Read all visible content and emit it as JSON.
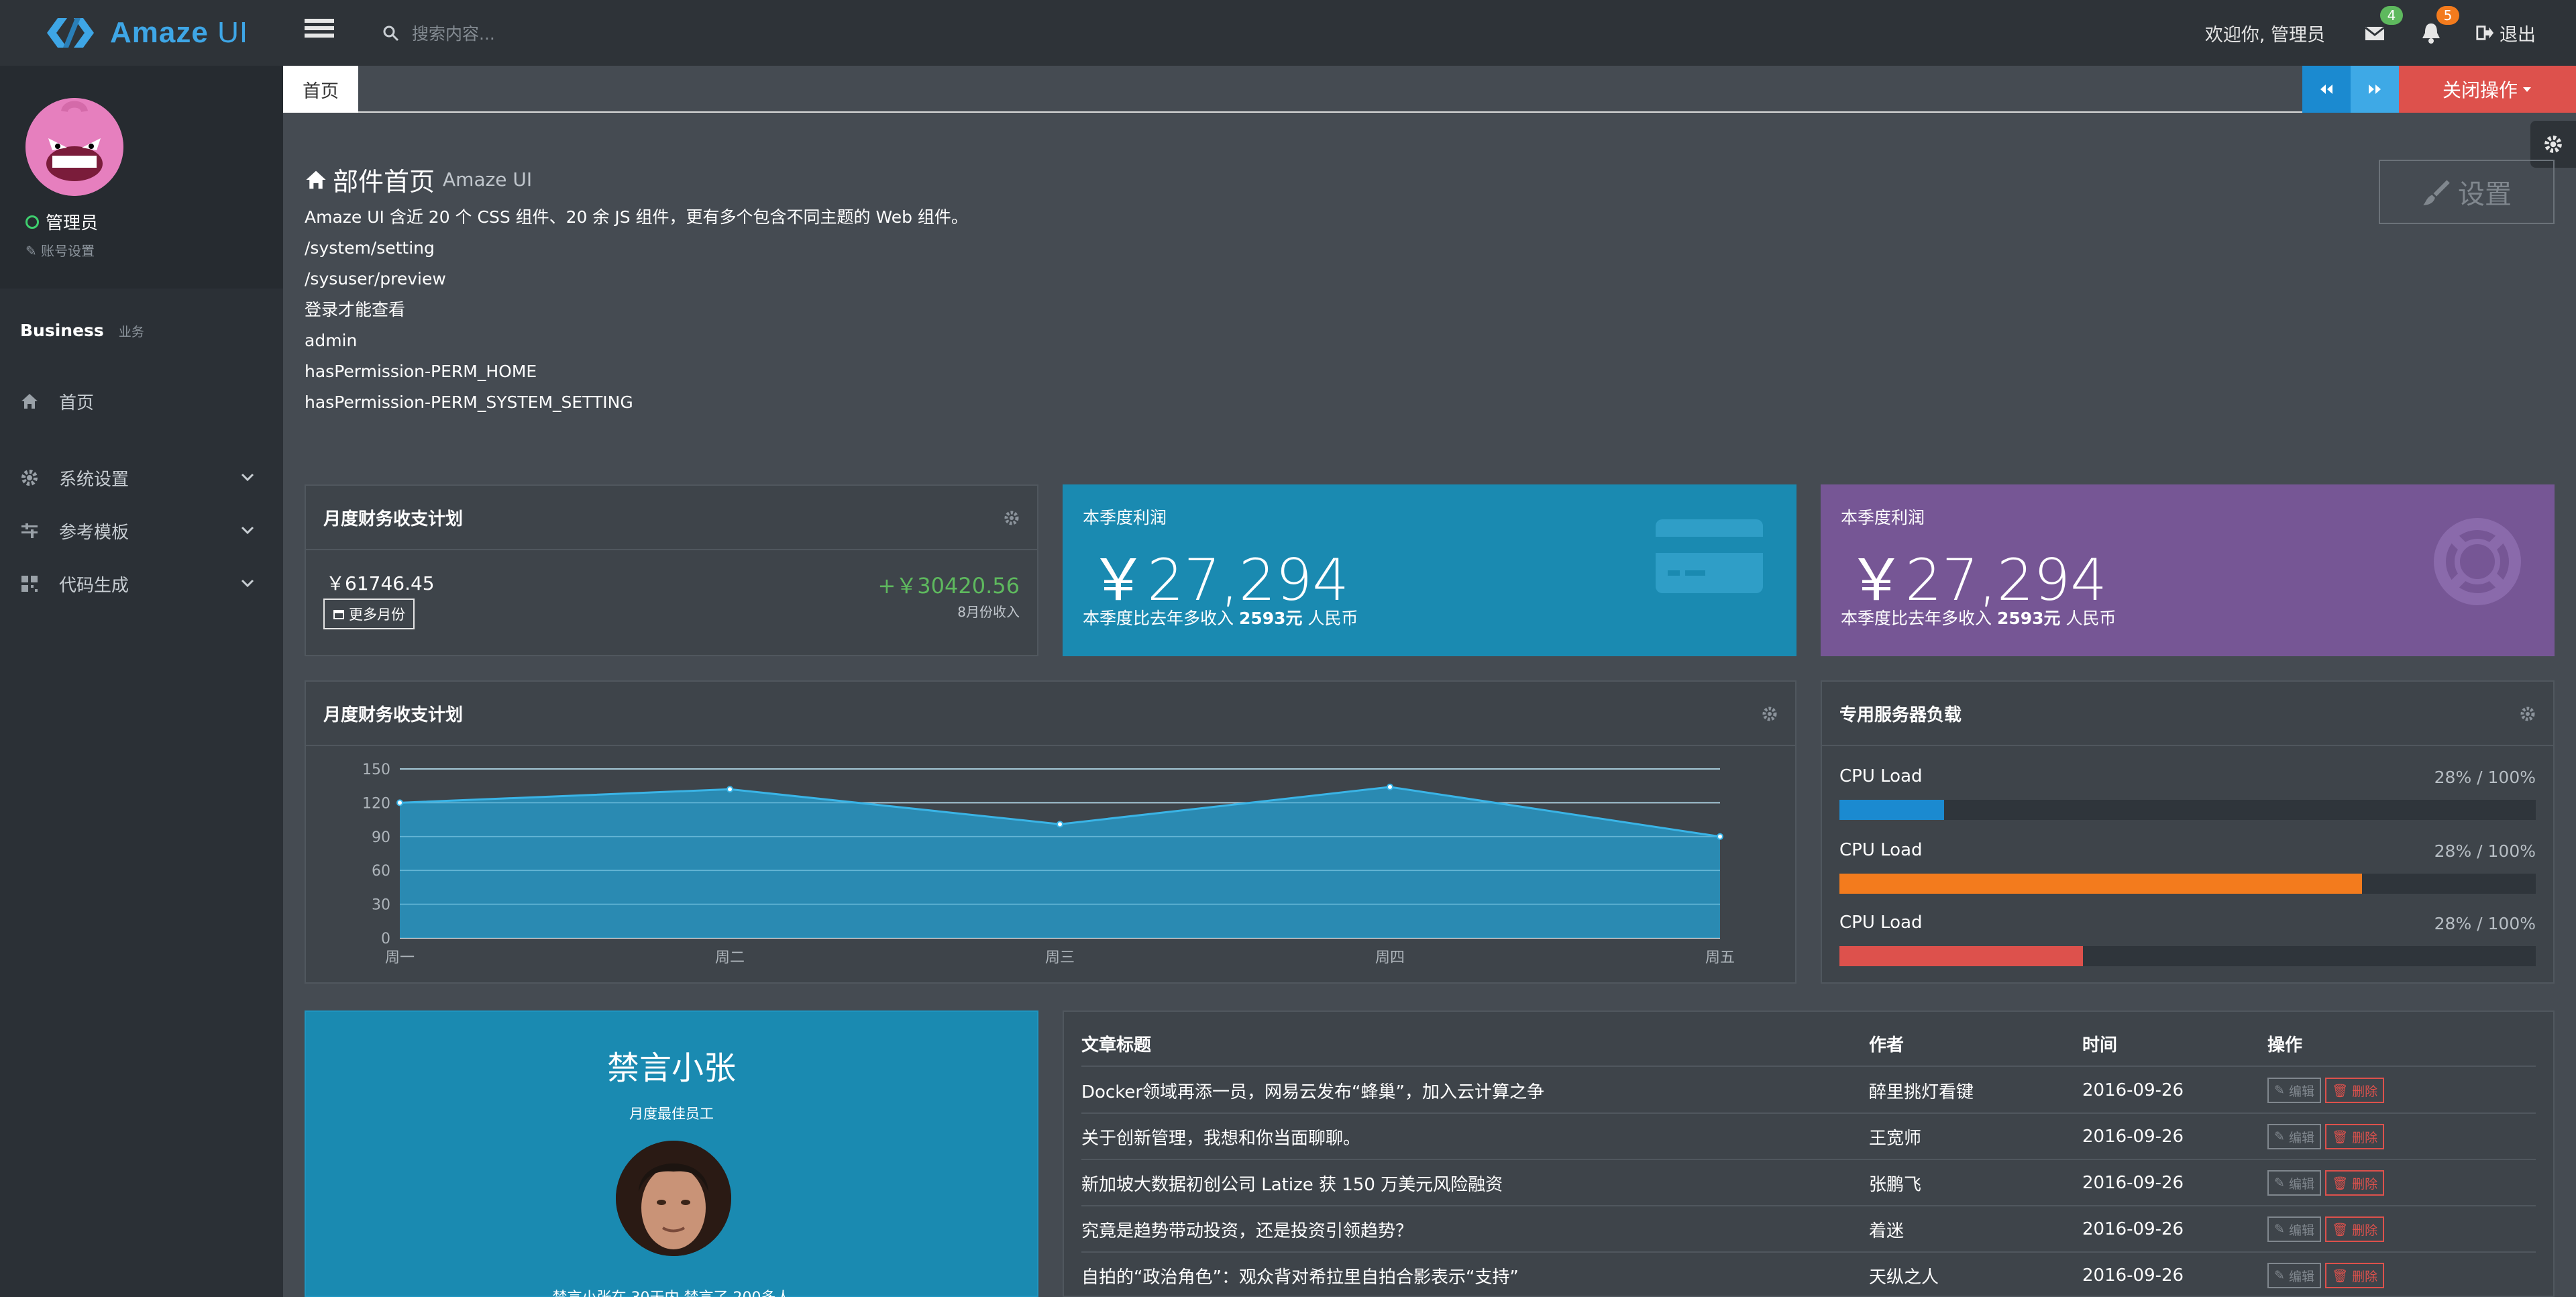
{
  "app": {
    "name_bold": "Amaze",
    "name_light": " UI"
  },
  "search": {
    "placeholder": "搜索内容..."
  },
  "header": {
    "welcome": "欢迎你, 管理员",
    "mail_count": "4",
    "notice_count": "5",
    "logout": "退出",
    "colors": {
      "mail_badge": "#5eb95e",
      "notice_badge": "#f37b1d"
    }
  },
  "sidebar": {
    "user": "管理员",
    "account_settings": "账号设置",
    "section": "Business",
    "section_sub": "业务",
    "items": [
      {
        "label": "首页",
        "icon": "home-icon"
      },
      {
        "label": "系统设置",
        "icon": "cog-icon"
      },
      {
        "label": "参考模板",
        "icon": "sliders-icon"
      },
      {
        "label": "代码生成",
        "icon": "qrcode-icon"
      }
    ]
  },
  "tabs": {
    "home": "首页",
    "close": "关闭操作"
  },
  "page": {
    "title": "部件首页",
    "subtitle": "Amaze UI",
    "lines": [
      "Amaze UI 含近 20 个 CSS 组件、20 余 JS 组件，更有多个包含不同主题的 Web 组件。",
      "/system/setting",
      "/sysuser/preview",
      "登录才能查看",
      "admin",
      "hasPermission-PERM_HOME",
      "hasPermission-PERM_SYSTEM_SETTING"
    ],
    "settings_button": "设置"
  },
  "finance": {
    "title": "月度财务收支计划",
    "amount": "￥61746.45",
    "more_months": "更多月份",
    "income": "+￥30420.56",
    "income_label": "8月份收入"
  },
  "profit_blue": {
    "label": "本季度利润",
    "value": "￥27,294",
    "sub_prefix": "本季度比去年多收入 ",
    "sub_value": "2593元",
    "sub_suffix": " 人民币",
    "color": "#1a8ab1"
  },
  "profit_purple": {
    "label": "本季度利润",
    "value": "￥27,294",
    "sub_prefix": "本季度比去年多收入 ",
    "sub_value": "2593元",
    "sub_suffix": " 人民币",
    "color": "#765695"
  },
  "chart_panel": {
    "title": "月度财务收支计划"
  },
  "chart_data": {
    "type": "area",
    "categories": [
      "周一",
      "周二",
      "周三",
      "周四",
      "周五"
    ],
    "values": [
      120,
      132,
      101,
      134,
      90
    ],
    "ylim": [
      0,
      150
    ],
    "yticks": [
      0,
      30,
      60,
      90,
      120,
      150
    ],
    "title": "",
    "xlabel": "",
    "ylabel": "",
    "color": "#2796c4",
    "grid": true
  },
  "server": {
    "title": "专用服务器负载",
    "rows": [
      {
        "label": "CPU Load",
        "value": "28% / 100%",
        "fill": 0.15,
        "color": "#1b8ad0"
      },
      {
        "label": "CPU Load",
        "value": "28% / 100%",
        "fill": 0.75,
        "color": "#f37b1d"
      },
      {
        "label": "CPU Load",
        "value": "28% / 100%",
        "fill": 0.35,
        "color": "#dd514c"
      }
    ]
  },
  "employee": {
    "name": "禁言小张",
    "title": "月度最佳员工",
    "desc": "禁言小张在 30天内 禁言了 200多人"
  },
  "articles": {
    "headers": {
      "title": "文章标题",
      "author": "作者",
      "time": "时间",
      "ops": "操作"
    },
    "edit": "编辑",
    "delete": "删除",
    "rows": [
      {
        "title": "Docker领域再添一员，网易云发布“蜂巢”，加入云计算之争",
        "author": "醉里挑灯看键",
        "time": "2016-09-26"
      },
      {
        "title": "关于创新管理，我想和你当面聊聊。",
        "author": "王宽师",
        "time": "2016-09-26"
      },
      {
        "title": "新加坡大数据初创公司 Latize 获 150 万美元风险融资",
        "author": "张鹏飞",
        "time": "2016-09-26"
      },
      {
        "title": "究竟是趋势带动投资，还是投资引领趋势？",
        "author": "着迷",
        "time": "2016-09-26"
      },
      {
        "title": "自拍的“政治角色”：观众背对希拉里自拍合影表示“支持”",
        "author": "天纵之人",
        "time": "2016-09-26"
      }
    ]
  }
}
